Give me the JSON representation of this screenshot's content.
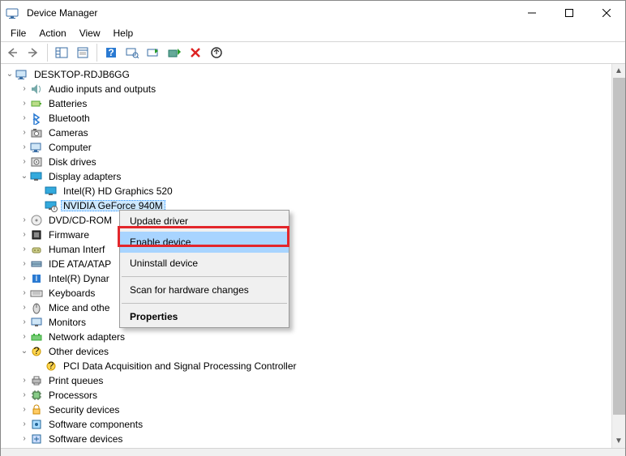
{
  "window": {
    "title": "Device Manager"
  },
  "menu": {
    "items": [
      "File",
      "Action",
      "View",
      "Help"
    ]
  },
  "tree": {
    "root": "DESKTOP-RDJB6GG",
    "categories": [
      {
        "label": "Audio inputs and outputs",
        "icon": "audio",
        "state": "collapsed"
      },
      {
        "label": "Batteries",
        "icon": "battery",
        "state": "collapsed"
      },
      {
        "label": "Bluetooth",
        "icon": "bluetooth",
        "state": "collapsed"
      },
      {
        "label": "Cameras",
        "icon": "camera",
        "state": "collapsed"
      },
      {
        "label": "Computer",
        "icon": "computer",
        "state": "collapsed"
      },
      {
        "label": "Disk drives",
        "icon": "disk",
        "state": "collapsed"
      },
      {
        "label": "Display adapters",
        "icon": "display",
        "state": "expanded",
        "children": [
          {
            "label": "Intel(R) HD Graphics 520",
            "icon": "display"
          },
          {
            "label": "NVIDIA GeForce 940M",
            "icon": "display-disabled",
            "selected": true
          }
        ]
      },
      {
        "label": "DVD/CD-ROM",
        "icon": "dvd",
        "state": "collapsed",
        "truncated_suffix": " "
      },
      {
        "label": "Firmware",
        "icon": "firmware",
        "state": "collapsed"
      },
      {
        "label": "Human Interf",
        "icon": "hid",
        "state": "collapsed",
        "truncated_suffix": ""
      },
      {
        "label": "IDE ATA/ATAP",
        "icon": "ide",
        "state": "collapsed",
        "truncated_suffix": ""
      },
      {
        "label": "Intel(R) Dynar",
        "icon": "intel",
        "state": "collapsed",
        "truncated_suffix": ""
      },
      {
        "label": "Keyboards",
        "icon": "keyboard",
        "state": "collapsed"
      },
      {
        "label": "Mice and othe",
        "icon": "mouse",
        "state": "collapsed",
        "truncated_suffix": ""
      },
      {
        "label": "Monitors",
        "icon": "monitor",
        "state": "collapsed"
      },
      {
        "label": "Network adapters",
        "icon": "network",
        "state": "collapsed"
      },
      {
        "label": "Other devices",
        "icon": "other",
        "state": "expanded",
        "children": [
          {
            "label": "PCI Data Acquisition and Signal Processing Controller",
            "icon": "other-warn"
          }
        ]
      },
      {
        "label": "Print queues",
        "icon": "printer",
        "state": "collapsed"
      },
      {
        "label": "Processors",
        "icon": "cpu",
        "state": "collapsed"
      },
      {
        "label": "Security devices",
        "icon": "security",
        "state": "collapsed"
      },
      {
        "label": "Software components",
        "icon": "swcomp",
        "state": "collapsed"
      },
      {
        "label": "Software devices",
        "icon": "swdev",
        "state": "collapsed"
      }
    ]
  },
  "context_menu": {
    "items": [
      {
        "label": "Update driver",
        "type": "item"
      },
      {
        "label": "Enable device",
        "type": "item",
        "highlighted": true
      },
      {
        "label": "Uninstall device",
        "type": "item"
      },
      {
        "type": "separator"
      },
      {
        "label": "Scan for hardware changes",
        "type": "item"
      },
      {
        "type": "separator"
      },
      {
        "label": "Properties",
        "type": "item",
        "bold": true
      }
    ]
  }
}
